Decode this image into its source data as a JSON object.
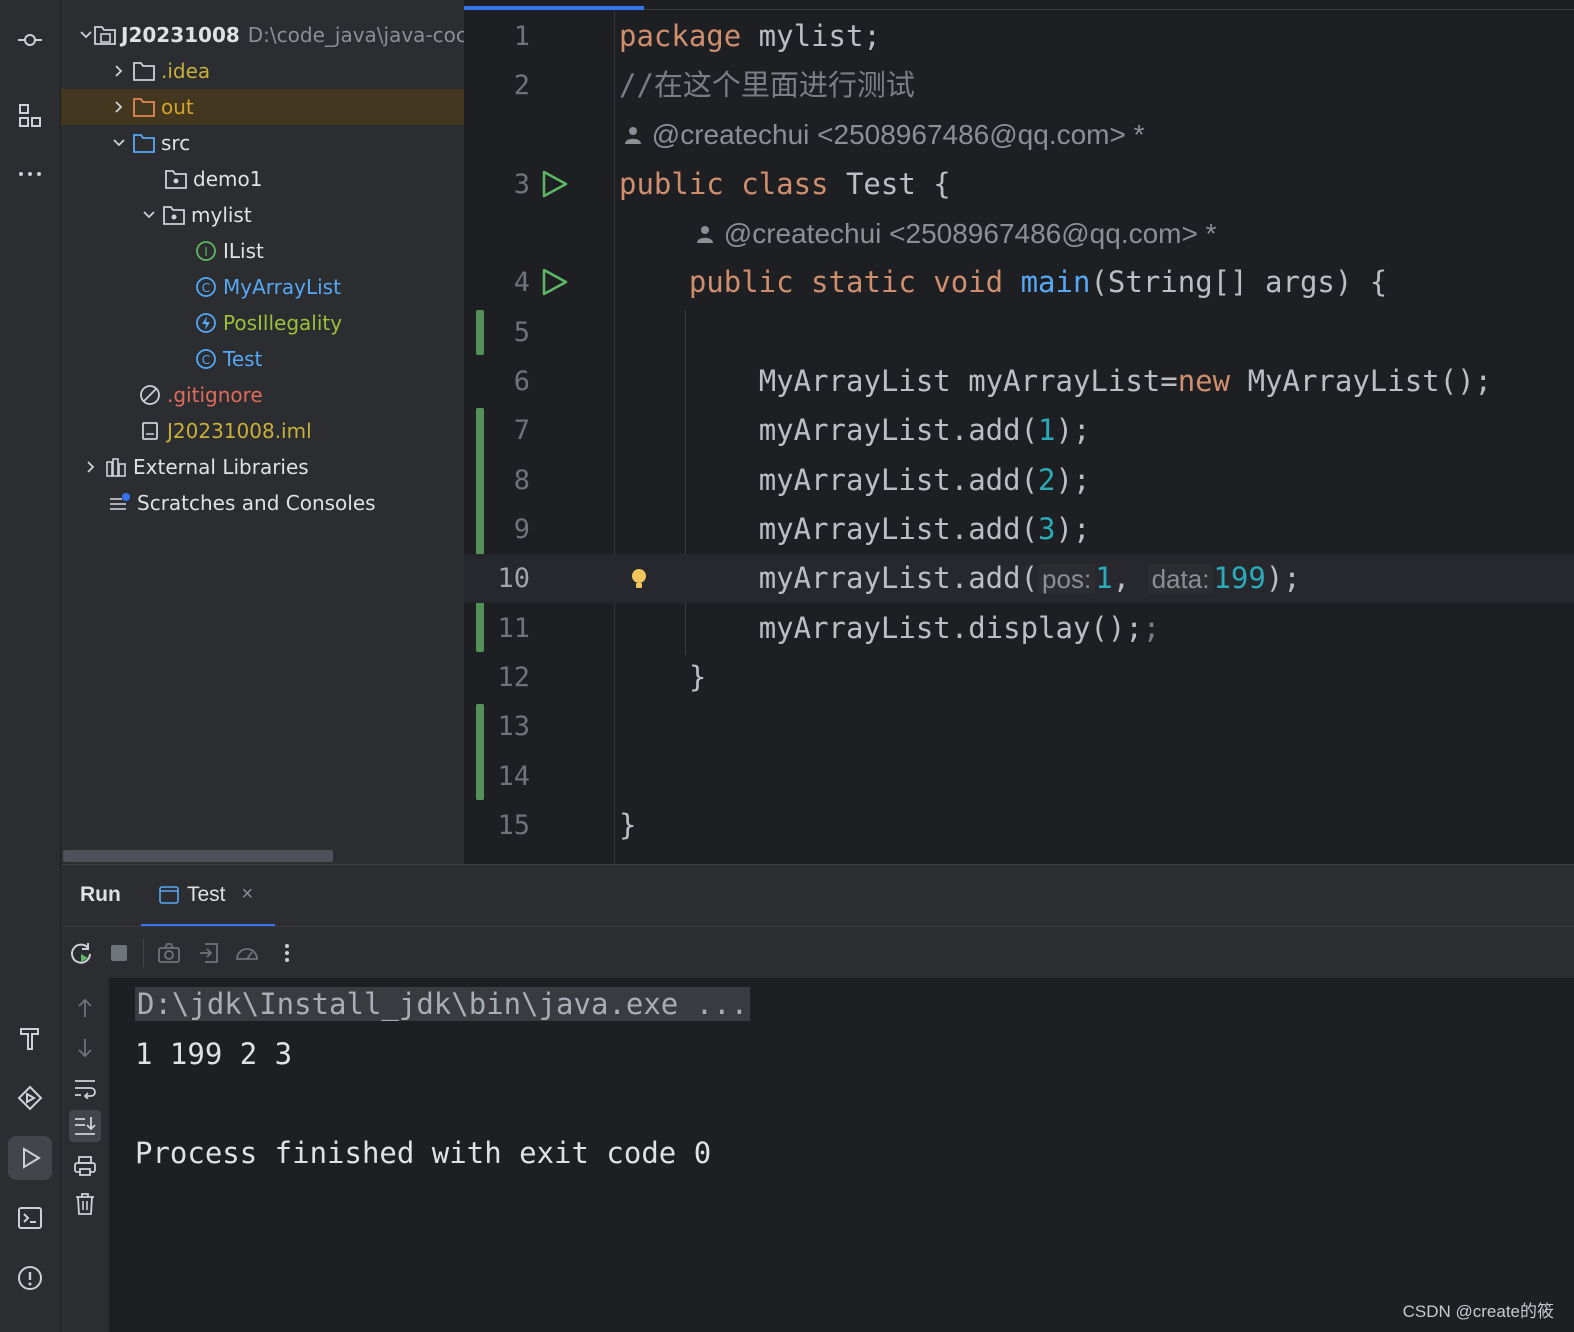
{
  "project": {
    "root_name": "J20231008",
    "root_path": "D:\\code_java\\java-coc",
    "items": [
      {
        "label": ".idea",
        "color": "#c9b03a"
      },
      {
        "label": "out",
        "color": "#d5a52a"
      },
      {
        "label": "src",
        "color": "#dfe1e5"
      },
      {
        "label": "demo1",
        "color": "#dfe1e5"
      },
      {
        "label": "mylist",
        "color": "#dfe1e5"
      },
      {
        "label": "IList",
        "color": "#dfe1e5"
      },
      {
        "label": "MyArrayList",
        "color": "#56a8f5"
      },
      {
        "label": "PosIllegality",
        "color": "#9fbf3b"
      },
      {
        "label": "Test",
        "color": "#56a8f5"
      },
      {
        "label": ".gitignore",
        "color": "#e06c5c"
      },
      {
        "label": "J20231008.iml",
        "color": "#c9b03a"
      },
      {
        "label": "External Libraries",
        "color": "#dfe1e5"
      },
      {
        "label": "Scratches and Consoles",
        "color": "#dfe1e5"
      }
    ]
  },
  "editor": {
    "line_numbers": [
      "1",
      "2",
      "3",
      "4",
      "5",
      "6",
      "7",
      "8",
      "9",
      "10",
      "11",
      "12",
      "13",
      "14",
      "15"
    ],
    "l1_kw": "package",
    "l1_rest": " mylist;",
    "l2_comment": "//在这个里面进行测试",
    "author1": "@createchui <2508967486@qq.com> *",
    "l3_kw": "public class",
    "l3_rest": " Test {",
    "author2": "@createchui <2508967486@qq.com> *",
    "l4_kw": "public static void",
    "l4_fn": "main",
    "l4_rest": "(String[] args) {",
    "l6_a": "MyArrayList myArrayList=",
    "l6_kw": "new",
    "l6_b": " MyArrayList();",
    "l7_a": "myArrayList.add(",
    "l7_n": "1",
    "l7_b": ");",
    "l8_a": "myArrayList.add(",
    "l8_n": "2",
    "l8_b": ");",
    "l9_a": "myArrayList.add(",
    "l9_n": "3",
    "l9_b": ");",
    "l10_a": "myArrayList.add(",
    "l10_hint1": "pos:",
    "l10_n1": "1",
    "l10_sep": ", ",
    "l10_hint2": "data:",
    "l10_n2": "199",
    "l10_b": ");",
    "l11": "myArrayList.display();",
    "l11_extra": ";",
    "l12": "}",
    "l15": "}"
  },
  "run": {
    "title": "Run",
    "tab_label": "Test",
    "tab_close": "×",
    "console": {
      "cmd": "D:\\jdk\\Install_jdk\\bin\\java.exe ...",
      "output": "1 199 2 3",
      "exit": "Process finished with exit code 0"
    }
  },
  "watermark": "CSDN @create的筱"
}
